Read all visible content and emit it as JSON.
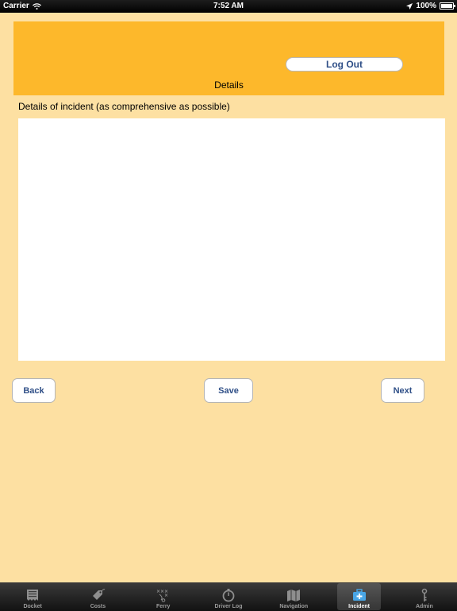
{
  "status_bar": {
    "carrier": "Carrier",
    "time": "7:52 AM",
    "battery": "100%"
  },
  "header": {
    "logout_label": "Log Out",
    "title": "Details"
  },
  "form": {
    "prompt": "Details of incident (as comprehensive as possible)",
    "details_value": ""
  },
  "actions": {
    "back_label": "Back",
    "save_label": "Save",
    "next_label": "Next"
  },
  "tabs": [
    {
      "label": "Docket",
      "icon": "docket-icon"
    },
    {
      "label": "Costs",
      "icon": "price-tag-icon"
    },
    {
      "label": "Ferry",
      "icon": "ferry-icon"
    },
    {
      "label": "Driver Log",
      "icon": "stopwatch-icon"
    },
    {
      "label": "Navigation",
      "icon": "map-icon"
    },
    {
      "label": "Incident",
      "icon": "first-aid-kit-icon",
      "active": true
    },
    {
      "label": "Admin",
      "icon": "key-icon"
    }
  ],
  "colors": {
    "background": "#fde0a2",
    "header": "#fdb82b",
    "button_text": "#2f4f87"
  }
}
